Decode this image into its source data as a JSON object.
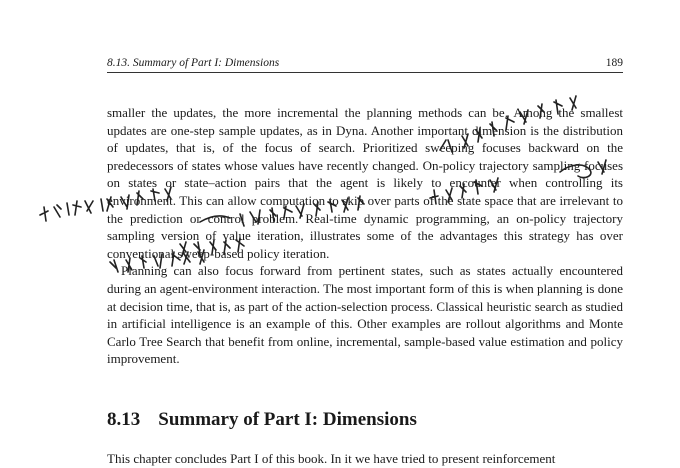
{
  "header": {
    "section_label": "8.13.  Summary of Part I: Dimensions",
    "page_number": "189"
  },
  "paragraphs": [
    "smaller the updates, the more incremental the planning methods can be. Among the smallest updates are one-step sample updates, as in Dyna. Another important dimension is the distribution of updates, that is, of the focus of search. Prioritized sweeping focuses backward on the predecessors of states whose values have recently changed. On-policy trajectory sampling focuses on states or state–action pairs that the agent is likely to encounter when controlling its environment. This can allow computation to skip over parts of the state space that are irrelevant to the prediction or control problem. Real-time dynamic programming, an on-policy trajectory sampling version of value iteration, illustrates some of the advantages this strategy has over conventional sweep-based policy iteration.",
    "Planning can also focus forward from pertinent states, such as states actually encountered during an agent-environment interaction. The most important form of this is when planning is done at decision time, that is, as part of the action-selection process. Classical heuristic search as studied in artificial intelligence is an example of this. Other examples are rollout algorithms and Monte Carlo Tree Search that benefit from online, incremental, sample-based value estimation and policy improvement."
  ],
  "section": {
    "number": "8.13",
    "title": "Summary of Part I: Dimensions",
    "first_line": "This chapter concludes Part I of this book. In it we have tried to present reinforcement"
  },
  "annotation": {
    "ink_color": "#222222"
  }
}
